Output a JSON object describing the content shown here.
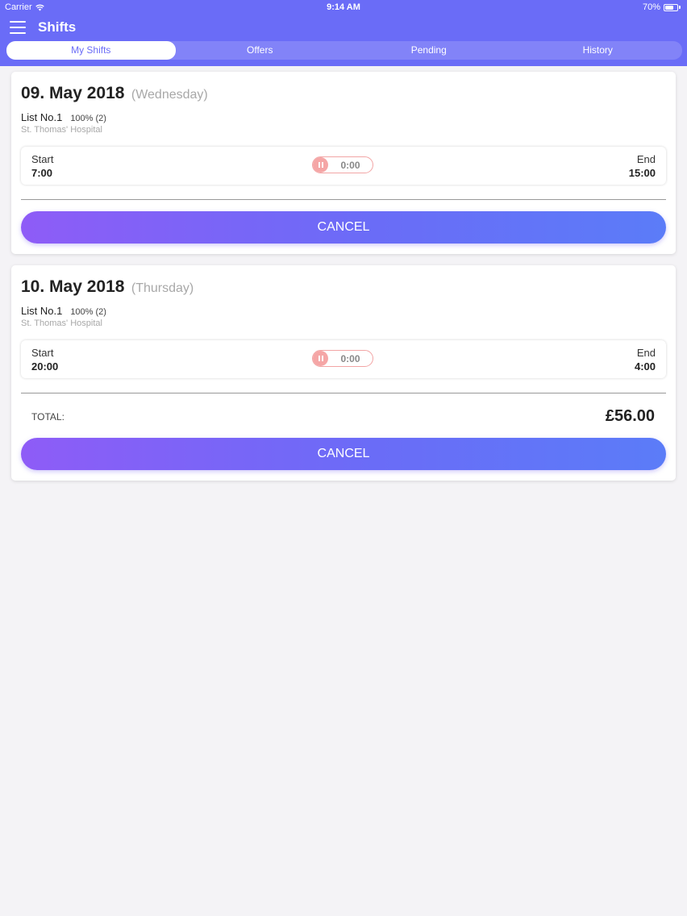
{
  "status_bar": {
    "carrier": "Carrier",
    "time": "9:14 AM",
    "battery": "70%",
    "battery_level": 0.7
  },
  "header": {
    "title": "Shifts"
  },
  "tabs": [
    {
      "label": "My Shifts"
    },
    {
      "label": "Offers"
    },
    {
      "label": "Pending"
    },
    {
      "label": "History"
    }
  ],
  "active_tab": "My Shifts",
  "shifts": [
    {
      "date": "09. May 2018",
      "weekday": "(Wednesday)",
      "list": "List No.1",
      "percent": "100% (2)",
      "hospital": "St. Thomas' Hospital",
      "start_label": "Start",
      "start": "7:00",
      "timer": "0:00",
      "end_label": "End",
      "end": "15:00",
      "cancel_label": "CANCEL"
    },
    {
      "date": "10. May 2018",
      "weekday": "(Thursday)",
      "list": "List No.1",
      "percent": "100% (2)",
      "hospital": "St. Thomas' Hospital",
      "start_label": "Start",
      "start": "20:00",
      "timer": "0:00",
      "end_label": "End",
      "end": "4:00",
      "total_label": "TOTAL:",
      "total": "£56.00",
      "cancel_label": "CANCEL"
    }
  ],
  "colors": {
    "accent": "#6a6cf7",
    "gradient_start": "#8e5cf7",
    "gradient_end": "#5b7cf8",
    "timer": "#f5a6a6"
  }
}
